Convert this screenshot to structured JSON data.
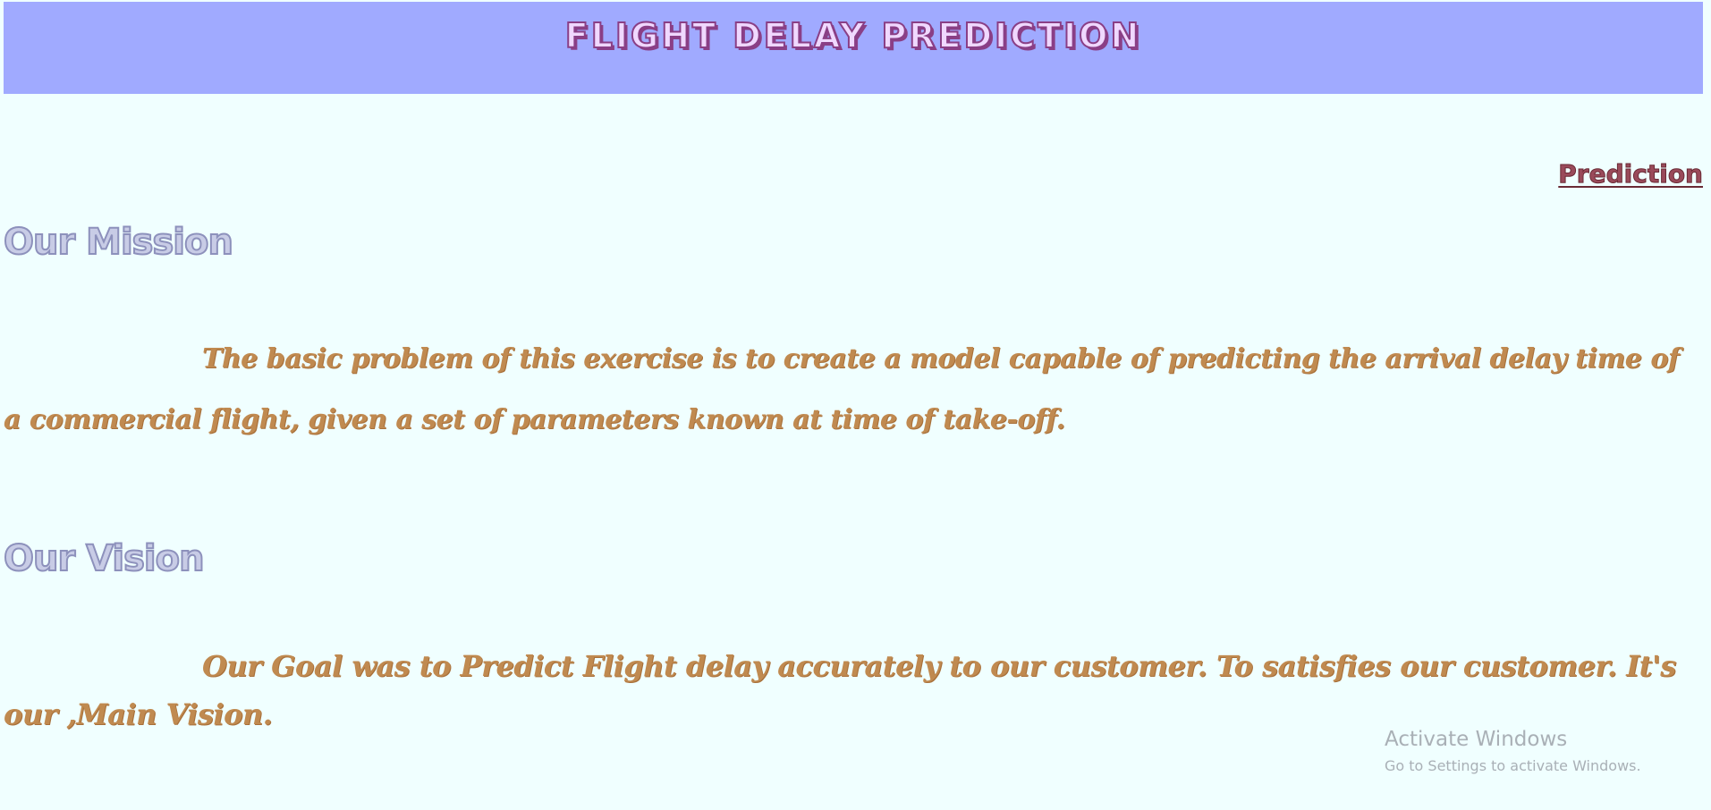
{
  "header": {
    "title": "FLIGHT DELAY PREDICTION"
  },
  "nav": {
    "prediction_link": "Prediction"
  },
  "mission": {
    "heading": "Our Mission",
    "text": "The basic problem of this exercise is to create a model capable of predicting the arrival delay time of a commercial flight, given a set of parameters known at time of take-off."
  },
  "vision": {
    "heading": "Our Vision",
    "text": "Our Goal was to Predict Flight delay accurately to our customer. To satisfies our customer. It's our ,Main Vision."
  },
  "watermark": {
    "title": "Activate Windows",
    "subtitle": "Go to Settings to activate Windows."
  },
  "colors": {
    "page_background": "#f0ffff",
    "header_background": "#a0aaff",
    "header_text": "#8a3f86",
    "link": "#9a4a5a",
    "heading": "#8d91bc",
    "paragraph": "#c08a50"
  }
}
